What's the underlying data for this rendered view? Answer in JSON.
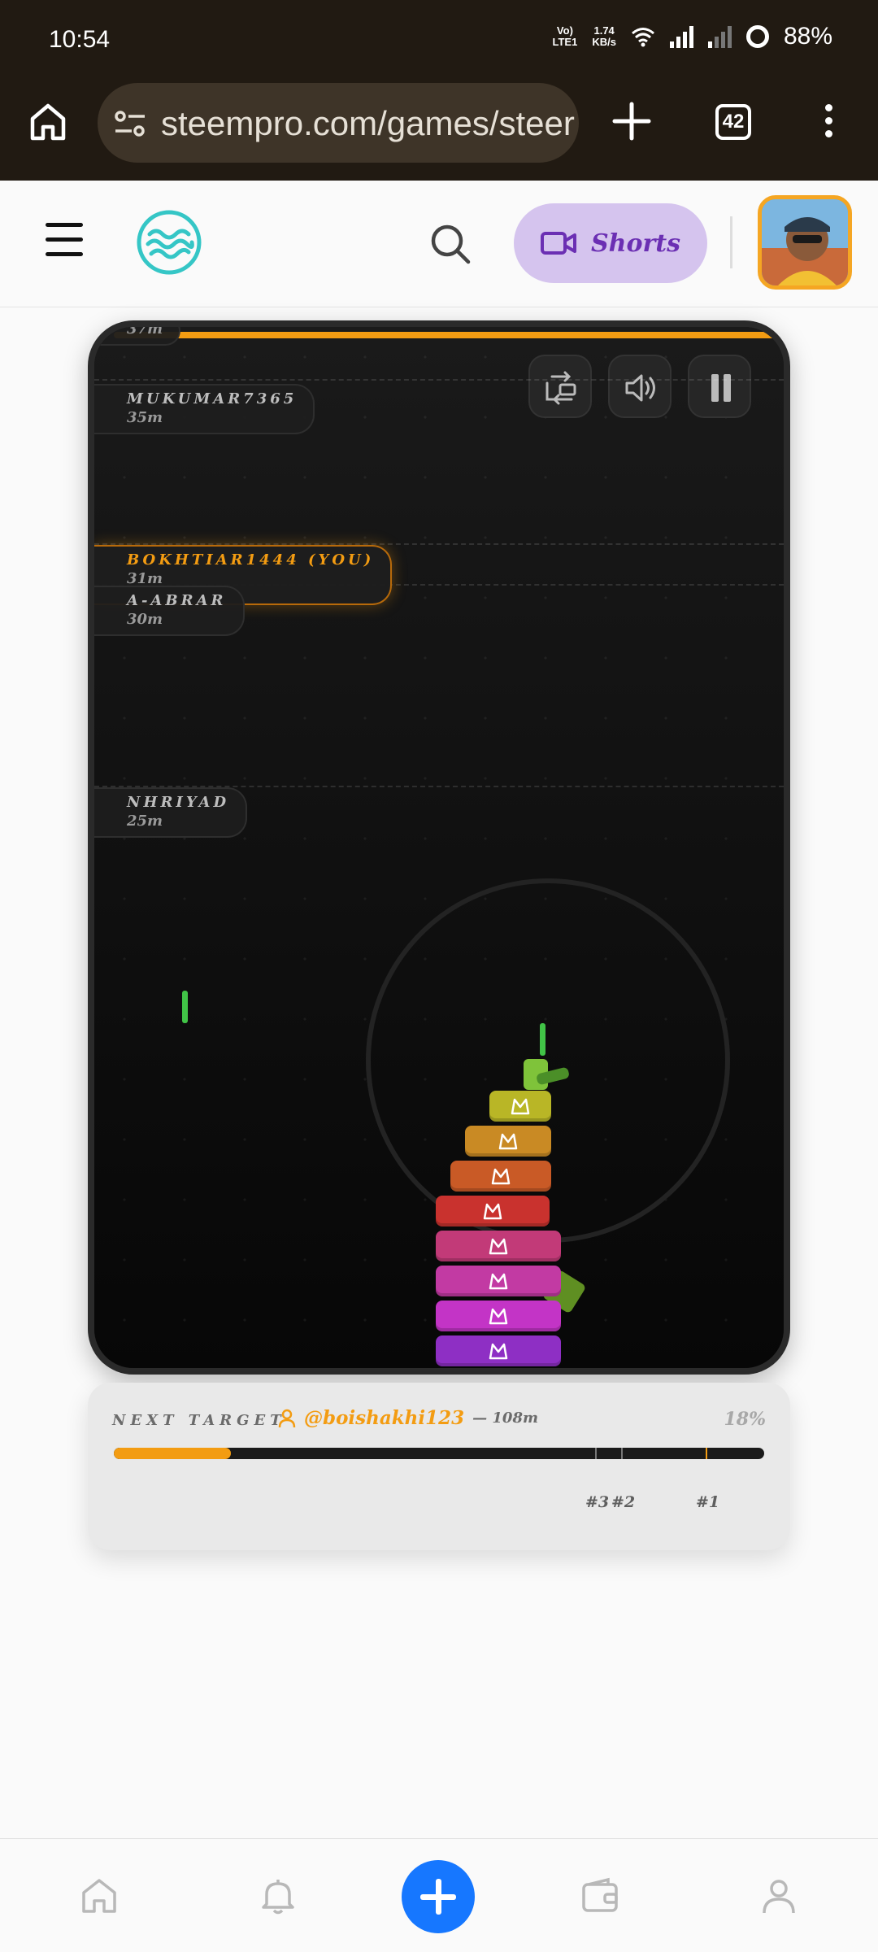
{
  "status_bar": {
    "time": "10:54",
    "network_top": "Vo)",
    "network_bottom": "LTE1",
    "speed_top": "1.74",
    "speed_bottom": "KB/s",
    "battery": "88%"
  },
  "browser": {
    "url": "steempro.com/games/steer",
    "tab_count": "42"
  },
  "header": {
    "shorts_label": "Shorts"
  },
  "game": {
    "accent_color": "#f39c12",
    "leaderboard": [
      {
        "name": "",
        "distance": "37m"
      },
      {
        "name": "MUKUMAR7365",
        "distance": "35m"
      },
      {
        "name": "BOKHTIAR1444 (YOU)",
        "distance": "31m"
      },
      {
        "name": "A-ABRAR",
        "distance": "30m"
      },
      {
        "name": "NHRIYAD",
        "distance": "25m"
      }
    ],
    "block_colors": [
      "#8e2fc4",
      "#c334c6",
      "#c23aa3",
      "#c23a78",
      "#c9322e",
      "#c95a26",
      "#c98a24",
      "#b9b626"
    ]
  },
  "next_target": {
    "label": "NEXT TARGET",
    "user": "@boishakhi123",
    "distance": "— 108m",
    "percent": "18%",
    "progress": 0.18,
    "ranks": [
      "#3",
      "#2",
      "#1"
    ]
  }
}
